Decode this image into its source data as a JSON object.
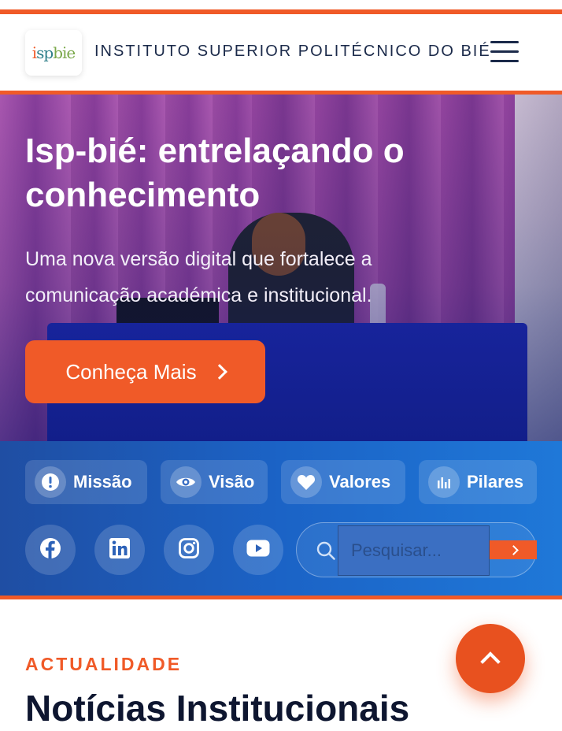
{
  "header": {
    "logo_text": "ispbie",
    "institution_name": "INSTITUTO SUPERIOR POLITÉCNICO DO BIÉ",
    "menu_icon": "hamburger-menu-icon"
  },
  "hero": {
    "title": "Isp-bié: entrelaçando o conhecimento",
    "subtitle": "Uma nova versão digital que fortalece a comunicação académica e institucional.",
    "cta_label": "Conheça Mais",
    "cta_icon": "chevron-right-icon"
  },
  "quick_links": [
    {
      "label": "Missão",
      "icon": "exclamation-icon"
    },
    {
      "label": "Visão",
      "icon": "eye-icon"
    },
    {
      "label": "Valores",
      "icon": "heart-icon"
    },
    {
      "label": "Pilares",
      "icon": "bar-chart-icon"
    }
  ],
  "social": [
    {
      "icon": "facebook-icon"
    },
    {
      "icon": "linkedin-icon"
    },
    {
      "icon": "instagram-icon"
    },
    {
      "icon": "youtube-icon"
    }
  ],
  "search": {
    "placeholder": "Pesquisar...",
    "icon": "search-icon",
    "submit_icon": "chevron-right-icon"
  },
  "news_section": {
    "kicker": "ACTUALIDADE",
    "title": "Notícias Institucionais"
  },
  "back_to_top": {
    "icon": "chevron-up-icon"
  },
  "colors": {
    "accent": "#f05a28",
    "navy": "#1b2a4a",
    "blue_band": "#1b63c6"
  }
}
